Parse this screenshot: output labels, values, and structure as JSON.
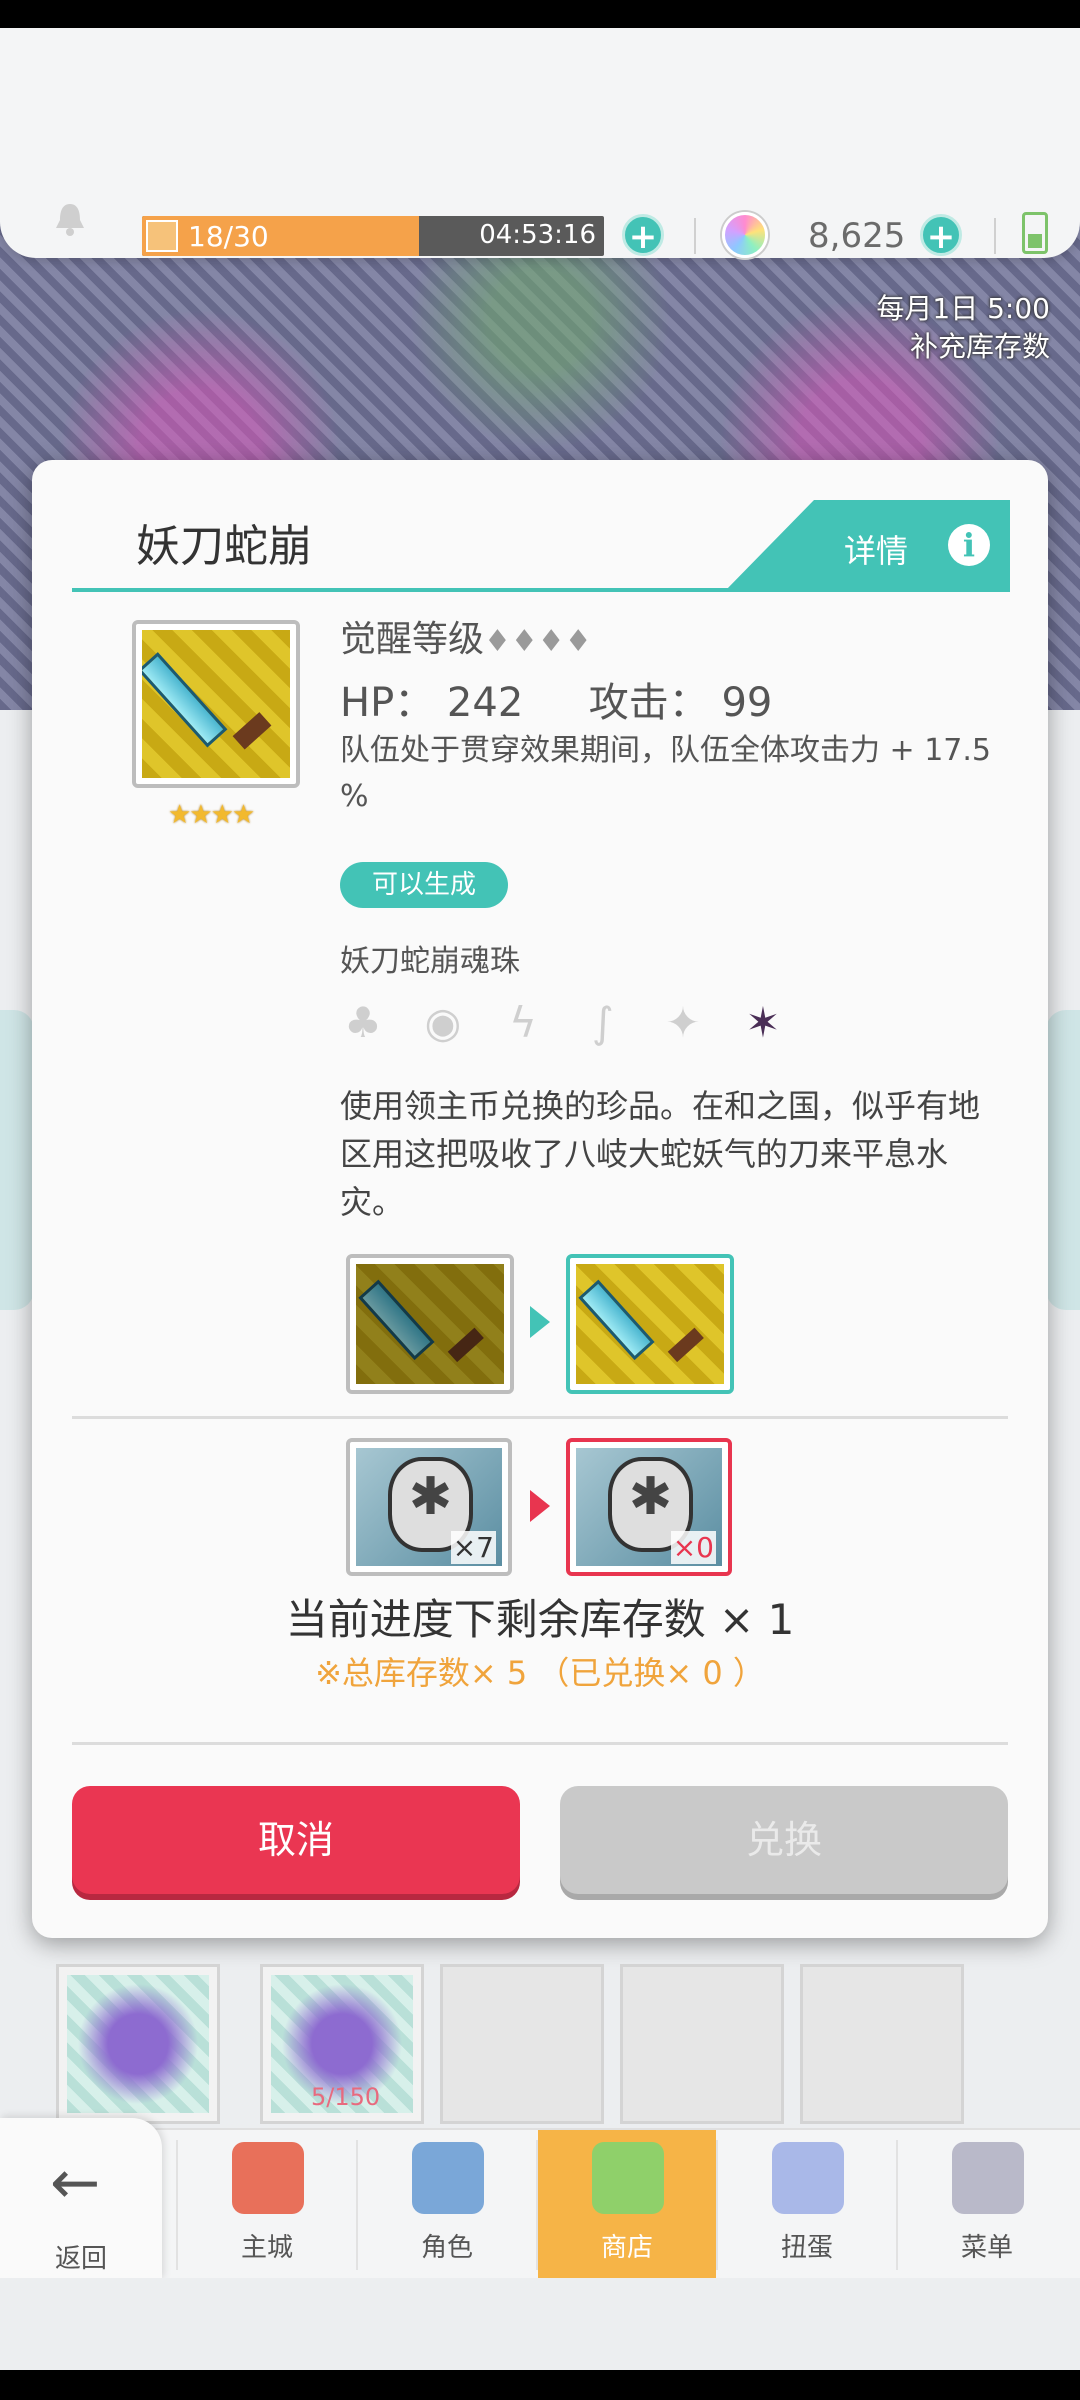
{
  "status": {
    "stamina_current": "18",
    "stamina_max": "30",
    "stamina_text": "18/30",
    "stamina_timer": "04:53:16",
    "stamina_fill_fraction": 0.6,
    "gems": "8,625"
  },
  "refill_notice": {
    "line1": "每月1日 5:00",
    "line2": "补充库存数"
  },
  "modal": {
    "title": "妖刀蛇崩",
    "details_label": "详情",
    "awaken_label": "觉醒等级",
    "awaken_diamonds": "♦♦♦♦",
    "stars": "★★★★",
    "hp_label": "HP：",
    "hp_value": "242",
    "atk_label": "攻击：",
    "atk_value": "99",
    "effect": "队伍处于贯穿效果期间，队伍全体攻击力 + 17.5 %",
    "badge": "可以生成",
    "orb_name": "妖刀蛇崩魂珠",
    "elements": [
      {
        "icon": "earth-element-icon",
        "glyph": "♣",
        "active": false
      },
      {
        "icon": "ring-element-icon",
        "glyph": "◉",
        "active": false
      },
      {
        "icon": "lightning-element-icon",
        "glyph": "ϟ",
        "active": false
      },
      {
        "icon": "wind-element-icon",
        "glyph": "∫",
        "active": false
      },
      {
        "icon": "light-element-icon",
        "glyph": "✦",
        "active": false
      },
      {
        "icon": "dark-element-icon",
        "glyph": "✶",
        "active": true
      }
    ],
    "description": "使用领主币兑换的珍品。在和之国，似乎有地区用这把吸收了八岐大蛇妖气的刀来平息水灾。",
    "cost_owned": "×7",
    "cost_required": "×0",
    "stock_text": "当前进度下剩余库存数 × 1",
    "stock_note": "※总库存数× 5 （已兑换× 0 ）",
    "cancel_label": "取消",
    "exchange_label": "兑换"
  },
  "inventory": {
    "slot2_count": "5/150"
  },
  "nav": {
    "back": "返回",
    "items": [
      {
        "label": "主城",
        "icon": "castle-icon"
      },
      {
        "label": "角色",
        "icon": "character-icon"
      },
      {
        "label": "商店",
        "icon": "shop-icon",
        "active": true
      },
      {
        "label": "扭蛋",
        "icon": "gacha-icon"
      },
      {
        "label": "菜单",
        "icon": "menu-icon"
      }
    ]
  },
  "colors": {
    "accent": "#43c3b6",
    "cancel": "#ea3652",
    "disabled": "#c9c9c9",
    "note": "#f0a43c",
    "stamina": "#f5a24a"
  }
}
